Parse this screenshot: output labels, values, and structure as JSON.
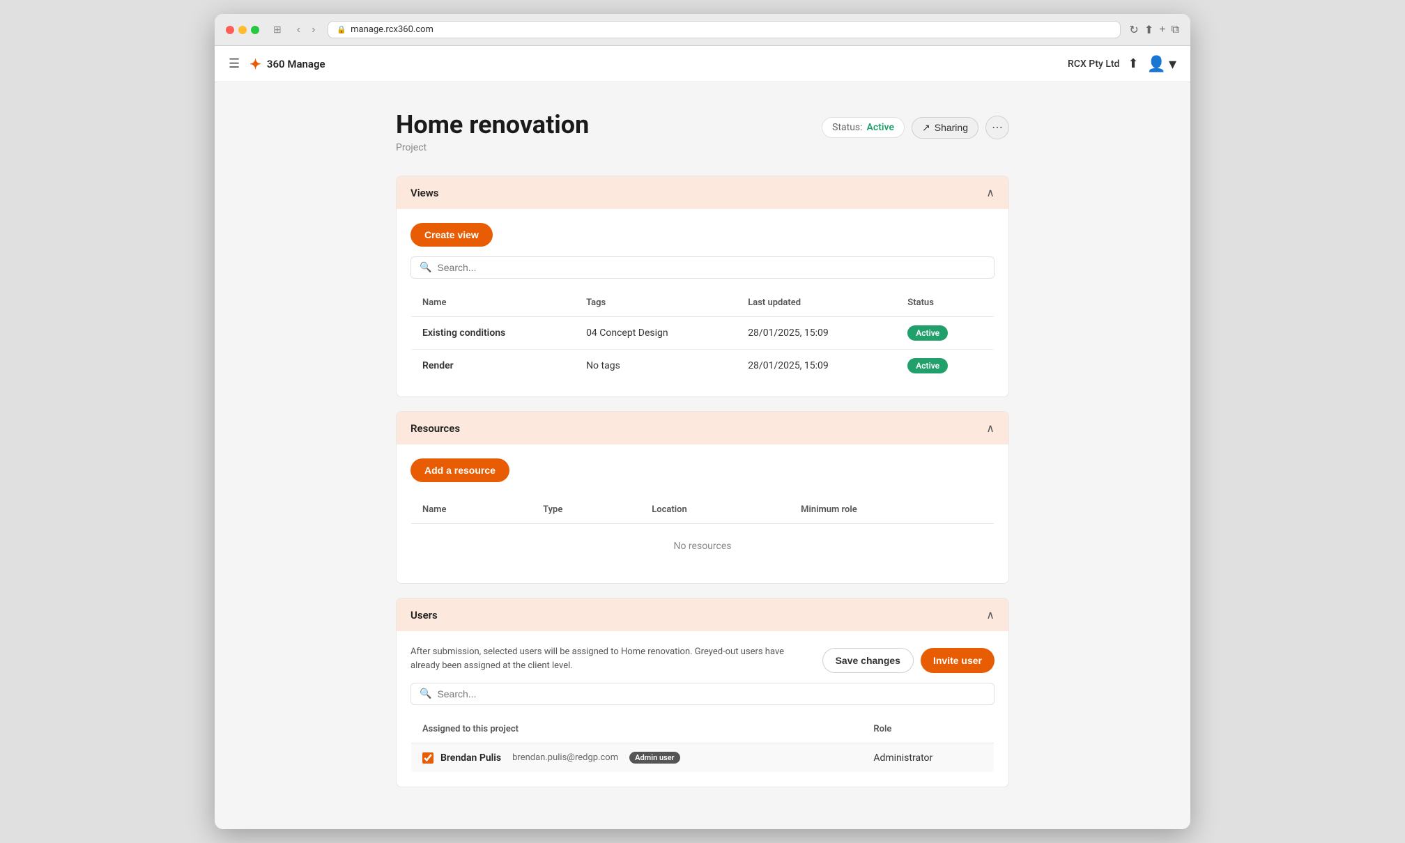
{
  "browser": {
    "url": "manage.rcx360.com",
    "back_label": "‹",
    "forward_label": "›"
  },
  "navbar": {
    "hamburger": "☰",
    "brand_icon": "✦",
    "brand_name": "360 Manage",
    "company": "RCX Pty Ltd",
    "upload_icon": "⬆",
    "avatar_icon": "👤",
    "chevron": "▾"
  },
  "project": {
    "title": "Home renovation",
    "subtitle": "Project",
    "status_label": "Status:",
    "status_value": "Active",
    "sharing_label": "Sharing",
    "more_label": "⋯"
  },
  "sections": {
    "views": {
      "title": "Views",
      "create_btn": "Create view",
      "search_placeholder": "Search...",
      "table_headers": [
        "Name",
        "Tags",
        "Last updated",
        "Status"
      ],
      "rows": [
        {
          "name": "Existing conditions",
          "tags": "04 Concept Design",
          "updated": "28/01/2025, 15:09",
          "status": "Active"
        },
        {
          "name": "Render",
          "tags": "No tags",
          "updated": "28/01/2025, 15:09",
          "status": "Active"
        }
      ]
    },
    "resources": {
      "title": "Resources",
      "add_btn": "Add a resource",
      "table_headers": [
        "Name",
        "Type",
        "Location",
        "Minimum role"
      ],
      "empty_label": "No resources"
    },
    "users": {
      "title": "Users",
      "info_text": "After submission, selected users will be assigned to Home renovation. Greyed-out users have already been assigned at the client level.",
      "save_btn": "Save changes",
      "invite_btn": "Invite user",
      "search_placeholder": "Search...",
      "assigned_header": "Assigned to this project",
      "role_header": "Role",
      "user_rows": [
        {
          "name": "Brendan Pulis",
          "email": "brendan.pulis@redgp.com",
          "badge": "Admin user",
          "role": "Administrator",
          "checked": true
        }
      ]
    }
  }
}
